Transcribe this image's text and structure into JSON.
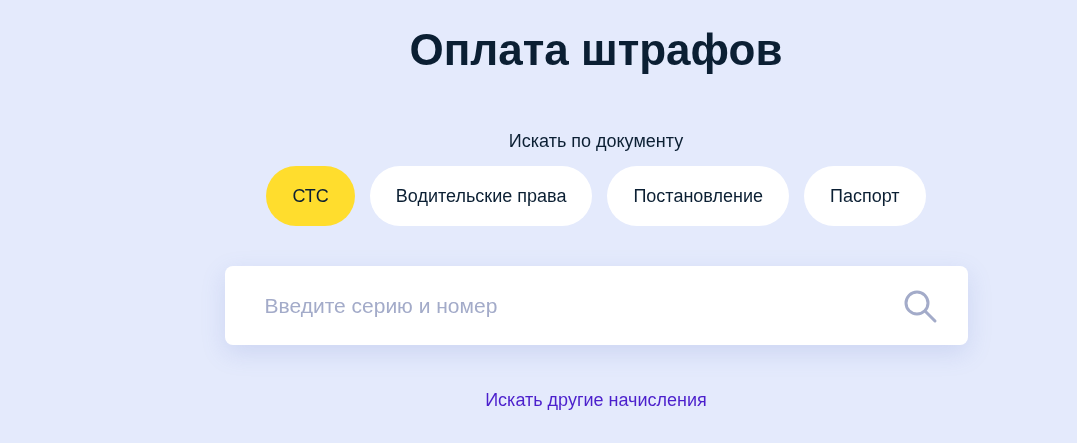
{
  "title": "Оплата штрафов",
  "search_by_label": "Искать по документу",
  "tabs": [
    {
      "label": "СТС",
      "selected": true
    },
    {
      "label": "Водительские права",
      "selected": false
    },
    {
      "label": "Постановление",
      "selected": false
    },
    {
      "label": "Паспорт",
      "selected": false
    }
  ],
  "search": {
    "placeholder": "Введите серию и номер"
  },
  "link": "Искать другие начисления"
}
